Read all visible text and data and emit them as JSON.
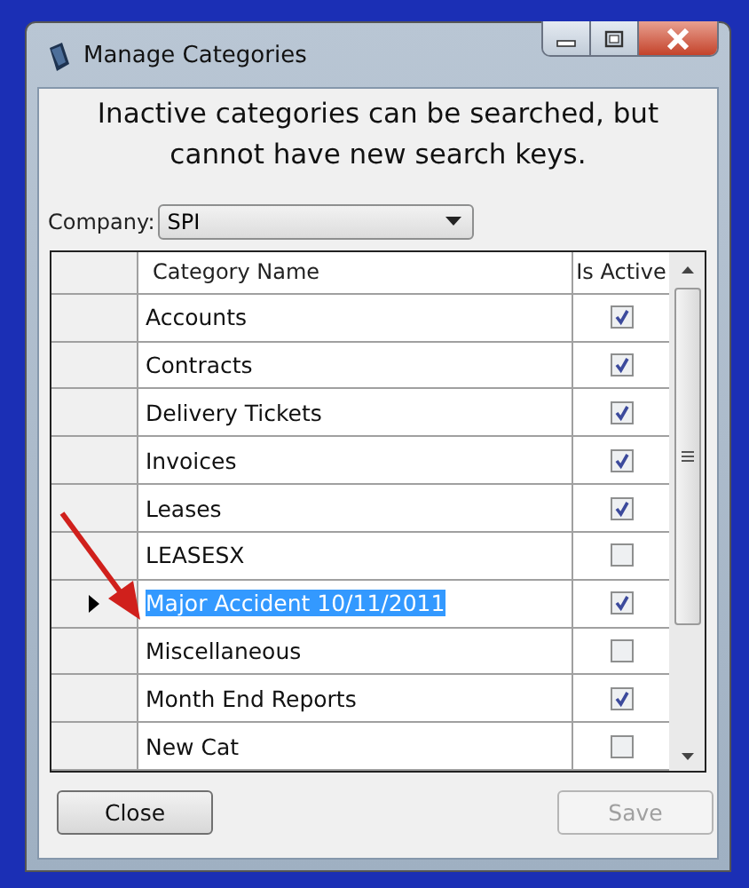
{
  "window": {
    "title": "Manage Categories"
  },
  "message": "Inactive categories can be searched, but cannot have new search keys.",
  "company": {
    "label": "Company:",
    "value": "SPI"
  },
  "table": {
    "columns": [
      "Category Name",
      "Is Active"
    ],
    "rows": [
      {
        "name": "Accounts",
        "active": true,
        "selected": false
      },
      {
        "name": "Contracts",
        "active": true,
        "selected": false
      },
      {
        "name": "Delivery Tickets",
        "active": true,
        "selected": false
      },
      {
        "name": "Invoices",
        "active": true,
        "selected": false
      },
      {
        "name": "Leases",
        "active": true,
        "selected": false
      },
      {
        "name": "LEASESX",
        "active": false,
        "selected": false
      },
      {
        "name": "Major Accident 10/11/2011",
        "active": true,
        "selected": true
      },
      {
        "name": "Miscellaneous",
        "active": false,
        "selected": false
      },
      {
        "name": "Month End Reports",
        "active": true,
        "selected": false
      },
      {
        "name": "New Cat",
        "active": false,
        "selected": false
      }
    ]
  },
  "buttons": [
    {
      "label": "Close",
      "disabled": false
    },
    {
      "label": "Save",
      "disabled": true
    }
  ]
}
